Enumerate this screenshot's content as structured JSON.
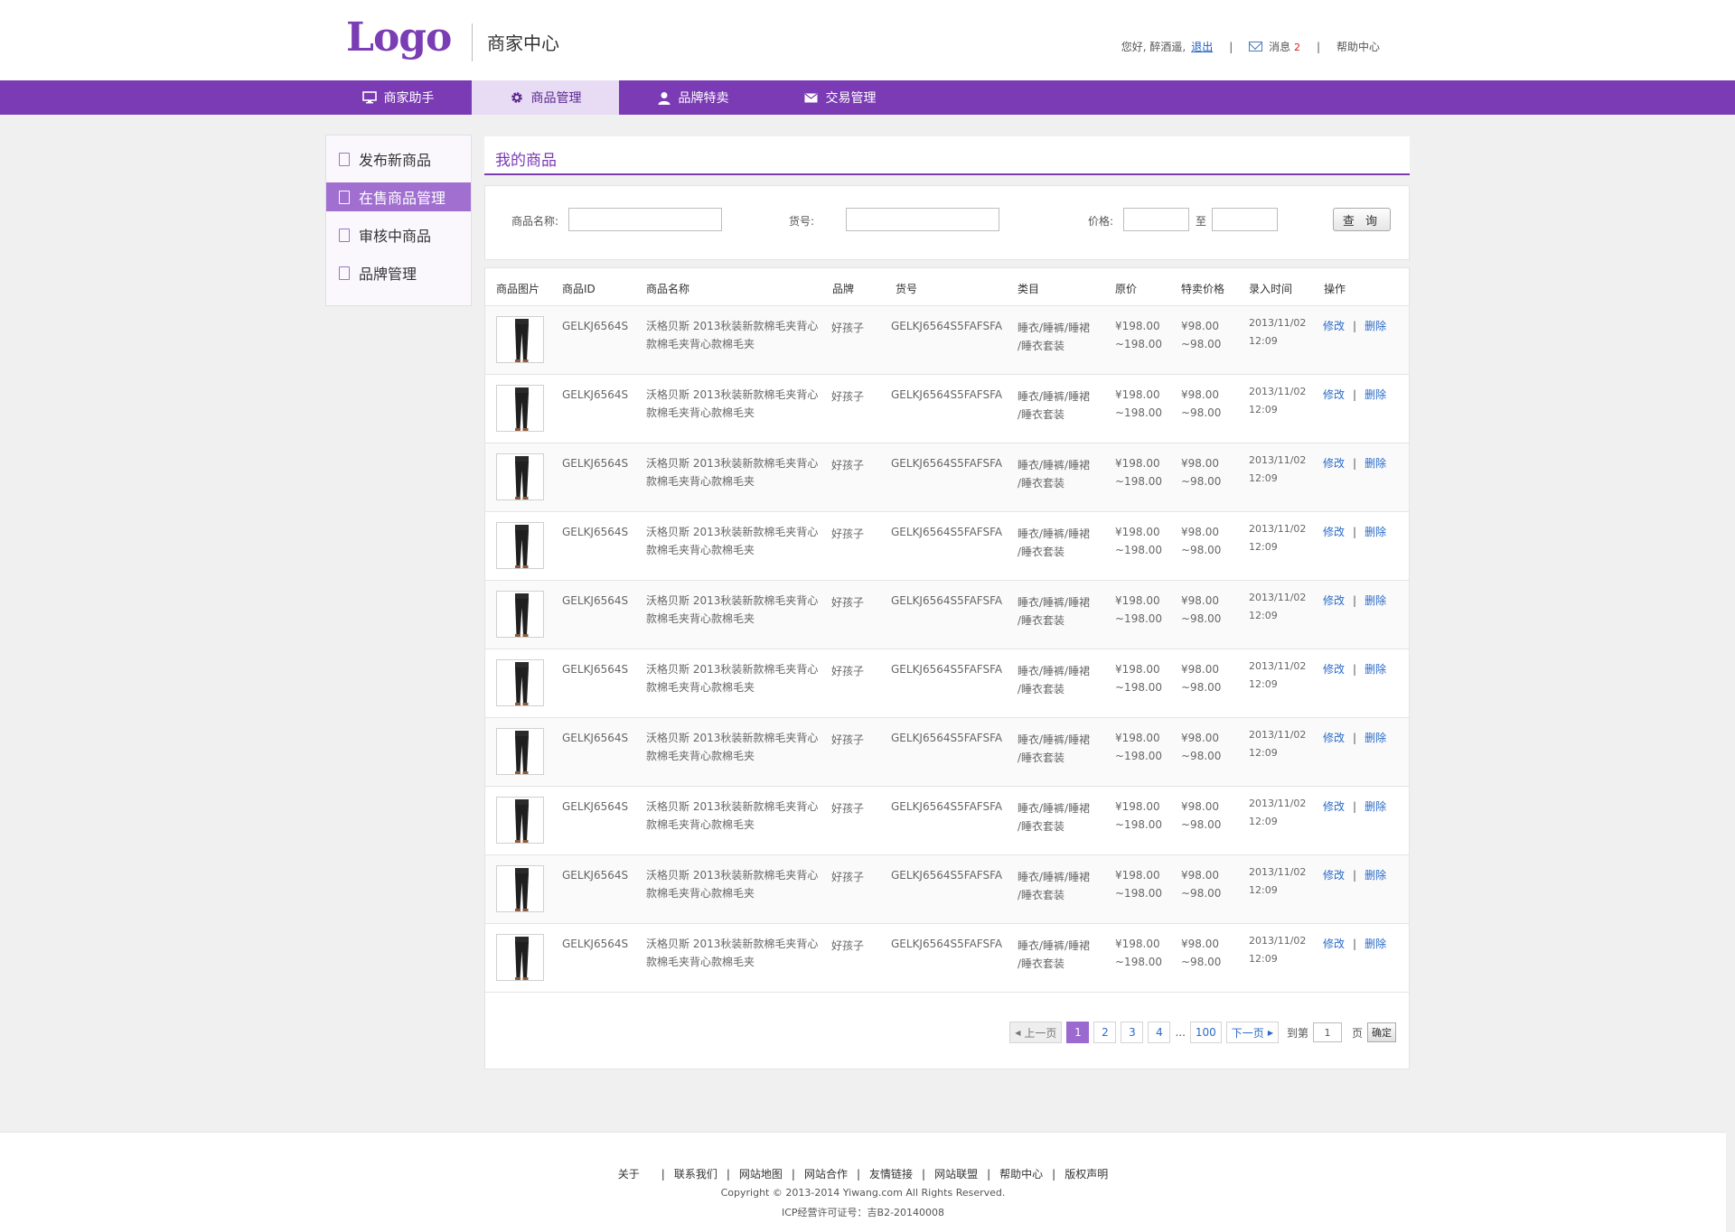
{
  "header": {
    "logo": "Logo",
    "site_name": "商家中心",
    "greeting": "您好, 醉酒遥,",
    "logout": "退出",
    "messages_label": "消息",
    "messages_count": "2",
    "help": "帮助中心"
  },
  "nav": [
    {
      "label": "商家助手",
      "icon": "monitor-icon"
    },
    {
      "label": "商品管理",
      "icon": "gear-icon"
    },
    {
      "label": "品牌特卖",
      "icon": "user-icon"
    },
    {
      "label": "交易管理",
      "icon": "mail-icon"
    }
  ],
  "sidebar": [
    {
      "label": "发布新商品"
    },
    {
      "label": "在售商品管理"
    },
    {
      "label": "审核中商品"
    },
    {
      "label": "品牌管理"
    }
  ],
  "panel_title": "我的商品",
  "search": {
    "name_label": "商品名称:",
    "sku_label": "货号:",
    "price_label": "价格:",
    "to_label": "至",
    "query_button": "查 询"
  },
  "table": {
    "headers": [
      "商品图片",
      "商品ID",
      "商品名称",
      "品牌",
      "货号",
      "类目",
      "原价",
      "特卖价格",
      "录入时间",
      "操作"
    ],
    "rows": [
      {
        "id": "GELKJ6564S",
        "name1": "沃格贝斯 2013秋装新款棉毛夹背心",
        "name2": "款棉毛夹背心款棉毛夹",
        "brand": "好孩子",
        "sku": "GELKJ6564S5FAFSFA",
        "cat1": "睡衣/睡裤/睡裙",
        "cat2": "/睡衣套装",
        "price1": "¥198.00",
        "price2": "~198.00",
        "sale1": "¥98.00",
        "sale2": "~98.00",
        "date": "2013/11/02",
        "time": "12:09",
        "edit": "修改",
        "del": "删除"
      },
      {
        "id": "GELKJ6564S",
        "name1": "沃格贝斯 2013秋装新款棉毛夹背心",
        "name2": "款棉毛夹背心款棉毛夹",
        "brand": "好孩子",
        "sku": "GELKJ6564S5FAFSFA",
        "cat1": "睡衣/睡裤/睡裙",
        "cat2": "/睡衣套装",
        "price1": "¥198.00",
        "price2": "~198.00",
        "sale1": "¥98.00",
        "sale2": "~98.00",
        "date": "2013/11/02",
        "time": "12:09",
        "edit": "修改",
        "del": "删除"
      },
      {
        "id": "GELKJ6564S",
        "name1": "沃格贝斯 2013秋装新款棉毛夹背心",
        "name2": "款棉毛夹背心款棉毛夹",
        "brand": "好孩子",
        "sku": "GELKJ6564S5FAFSFA",
        "cat1": "睡衣/睡裤/睡裙",
        "cat2": "/睡衣套装",
        "price1": "¥198.00",
        "price2": "~198.00",
        "sale1": "¥98.00",
        "sale2": "~98.00",
        "date": "2013/11/02",
        "time": "12:09",
        "edit": "修改",
        "del": "删除"
      },
      {
        "id": "GELKJ6564S",
        "name1": "沃格贝斯 2013秋装新款棉毛夹背心",
        "name2": "款棉毛夹背心款棉毛夹",
        "brand": "好孩子",
        "sku": "GELKJ6564S5FAFSFA",
        "cat1": "睡衣/睡裤/睡裙",
        "cat2": "/睡衣套装",
        "price1": "¥198.00",
        "price2": "~198.00",
        "sale1": "¥98.00",
        "sale2": "~98.00",
        "date": "2013/11/02",
        "time": "12:09",
        "edit": "修改",
        "del": "删除"
      },
      {
        "id": "GELKJ6564S",
        "name1": "沃格贝斯 2013秋装新款棉毛夹背心",
        "name2": "款棉毛夹背心款棉毛夹",
        "brand": "好孩子",
        "sku": "GELKJ6564S5FAFSFA",
        "cat1": "睡衣/睡裤/睡裙",
        "cat2": "/睡衣套装",
        "price1": "¥198.00",
        "price2": "~198.00",
        "sale1": "¥98.00",
        "sale2": "~98.00",
        "date": "2013/11/02",
        "time": "12:09",
        "edit": "修改",
        "del": "删除"
      },
      {
        "id": "GELKJ6564S",
        "name1": "沃格贝斯 2013秋装新款棉毛夹背心",
        "name2": "款棉毛夹背心款棉毛夹",
        "brand": "好孩子",
        "sku": "GELKJ6564S5FAFSFA",
        "cat1": "睡衣/睡裤/睡裙",
        "cat2": "/睡衣套装",
        "price1": "¥198.00",
        "price2": "~198.00",
        "sale1": "¥98.00",
        "sale2": "~98.00",
        "date": "2013/11/02",
        "time": "12:09",
        "edit": "修改",
        "del": "删除"
      },
      {
        "id": "GELKJ6564S",
        "name1": "沃格贝斯 2013秋装新款棉毛夹背心",
        "name2": "款棉毛夹背心款棉毛夹",
        "brand": "好孩子",
        "sku": "GELKJ6564S5FAFSFA",
        "cat1": "睡衣/睡裤/睡裙",
        "cat2": "/睡衣套装",
        "price1": "¥198.00",
        "price2": "~198.00",
        "sale1": "¥98.00",
        "sale2": "~98.00",
        "date": "2013/11/02",
        "time": "12:09",
        "edit": "修改",
        "del": "删除"
      },
      {
        "id": "GELKJ6564S",
        "name1": "沃格贝斯 2013秋装新款棉毛夹背心",
        "name2": "款棉毛夹背心款棉毛夹",
        "brand": "好孩子",
        "sku": "GELKJ6564S5FAFSFA",
        "cat1": "睡衣/睡裤/睡裙",
        "cat2": "/睡衣套装",
        "price1": "¥198.00",
        "price2": "~198.00",
        "sale1": "¥98.00",
        "sale2": "~98.00",
        "date": "2013/11/02",
        "time": "12:09",
        "edit": "修改",
        "del": "删除"
      },
      {
        "id": "GELKJ6564S",
        "name1": "沃格贝斯 2013秋装新款棉毛夹背心",
        "name2": "款棉毛夹背心款棉毛夹",
        "brand": "好孩子",
        "sku": "GELKJ6564S5FAFSFA",
        "cat1": "睡衣/睡裤/睡裙",
        "cat2": "/睡衣套装",
        "price1": "¥198.00",
        "price2": "~198.00",
        "sale1": "¥98.00",
        "sale2": "~98.00",
        "date": "2013/11/02",
        "time": "12:09",
        "edit": "修改",
        "del": "删除"
      },
      {
        "id": "GELKJ6564S",
        "name1": "沃格贝斯 2013秋装新款棉毛夹背心",
        "name2": "款棉毛夹背心款棉毛夹",
        "brand": "好孩子",
        "sku": "GELKJ6564S5FAFSFA",
        "cat1": "睡衣/睡裤/睡裙",
        "cat2": "/睡衣套装",
        "price1": "¥198.00",
        "price2": "~198.00",
        "sale1": "¥98.00",
        "sale2": "~98.00",
        "date": "2013/11/02",
        "time": "12:09",
        "edit": "修改",
        "del": "删除"
      }
    ]
  },
  "pager": {
    "prev": "上一页",
    "pages": [
      "1",
      "2",
      "3",
      "4"
    ],
    "ellipsis": "...",
    "last": "100",
    "next": "下一页",
    "goto_label": "到第",
    "goto_value": "1",
    "page_unit": "页",
    "confirm": "确定"
  },
  "footer": {
    "links": [
      "关于",
      "联系我们",
      "网站地图",
      "网站合作",
      "友情链接",
      "网站联盟",
      "帮助中心",
      "版权声明"
    ],
    "copyright": "Copyright © 2013-2014 Yiwang.com All Rights Reserved.",
    "icp": "ICP经营许可证号：吉B2-20140008"
  },
  "colors": {
    "brand": "#7b3bb5",
    "active_side": "#a06fd0",
    "link": "#2a6ac8"
  }
}
